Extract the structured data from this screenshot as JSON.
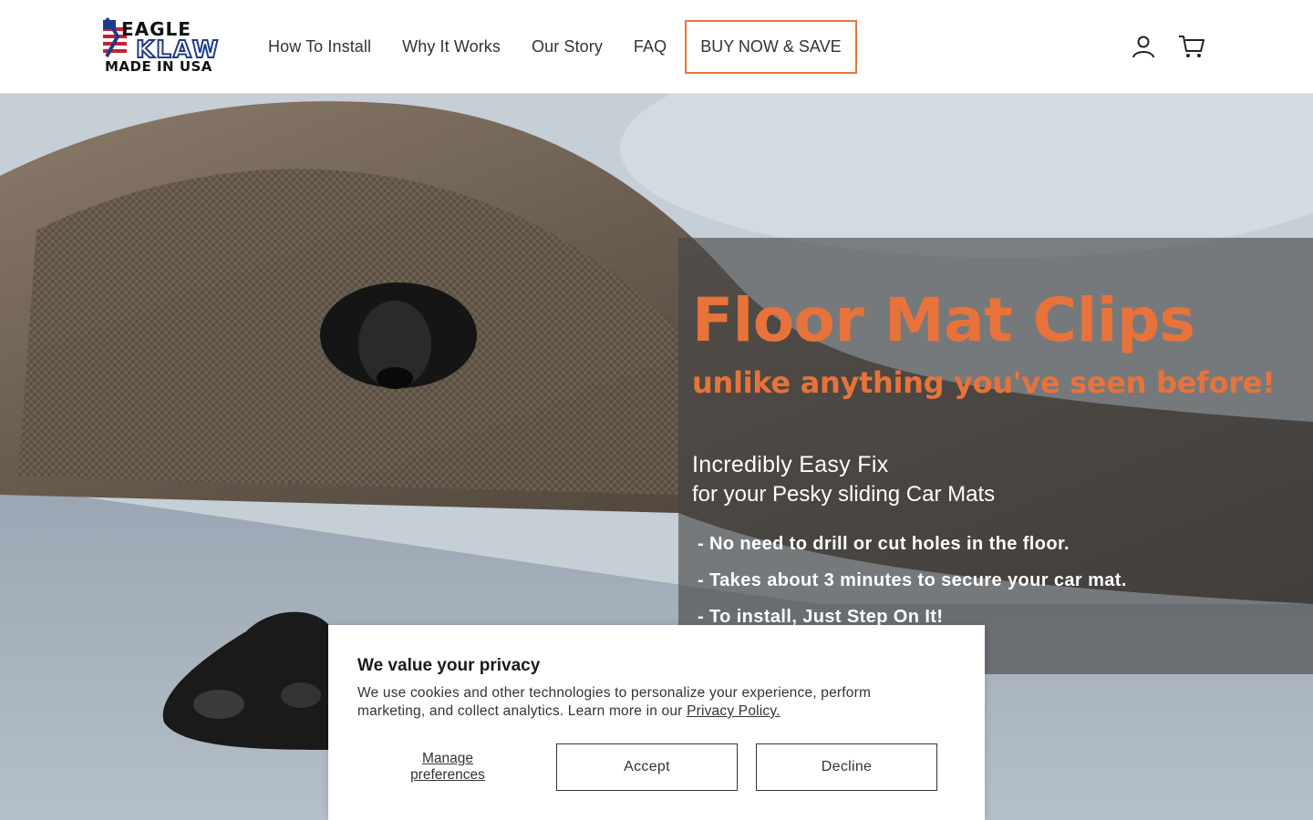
{
  "logo": {
    "brand_top": "EAGLE",
    "brand_main": "KLAW",
    "tagline": "MADE IN USA"
  },
  "nav": {
    "items": [
      {
        "label": "How To Install"
      },
      {
        "label": "Why It Works"
      },
      {
        "label": "Our Story"
      },
      {
        "label": "FAQ"
      }
    ],
    "cta_label": "BUY NOW & SAVE"
  },
  "header_icons": {
    "account": "account-icon",
    "cart": "cart-icon"
  },
  "hero": {
    "title": "Floor Mat Clips",
    "subtitle": "unlike anything you've seen before!",
    "tagline_1": "Incredibly Easy Fix",
    "tagline_2": "for your Pesky sliding Car Mats",
    "bullets": [
      "- No need to drill or cut holes in the floor.",
      "- Takes about 3 minutes to secure your car mat.",
      "- To install, Just Step On It!"
    ]
  },
  "cookie": {
    "title": "We value your privacy",
    "text": "We use cookies and other technologies to personalize your experience, perform marketing, and collect analytics. Learn more in our",
    "link_label": "Privacy Policy.",
    "manage_label": "Manage preferences",
    "accept_label": "Accept",
    "decline_label": "Decline"
  },
  "colors": {
    "accent": "#e8733a",
    "text": "#333333",
    "overlay": "rgba(70,70,70,0.62)"
  }
}
